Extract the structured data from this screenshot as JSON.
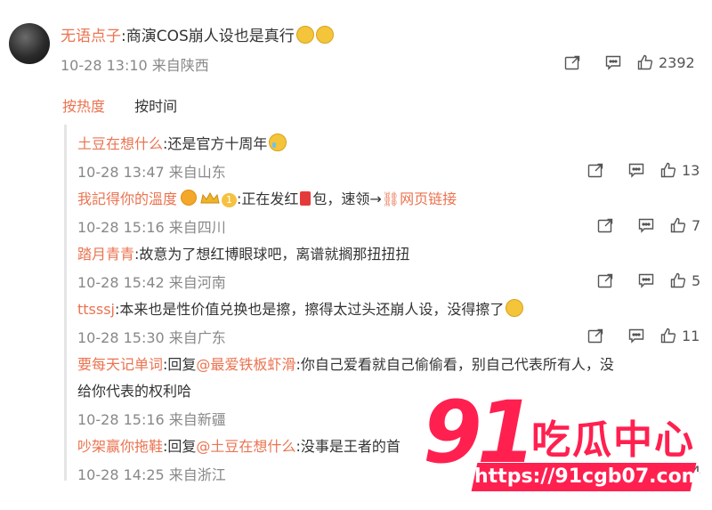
{
  "top_comment": {
    "username": "无语点子",
    "text": ":商演COS崩人设也是真行",
    "time": "10-28 13:10",
    "location": "来自陕西",
    "likes": "2392"
  },
  "sort": {
    "hot": "按热度",
    "time": "按时间"
  },
  "replies": [
    {
      "username": "土豆在想什么",
      "text": ":还是官方十周年",
      "time": "10-28 13:47",
      "location": "来自山东",
      "likes": "13"
    },
    {
      "username": "我記得你的溫度",
      "badge_level": "1",
      "text_before": ":正在发红",
      "text_after": "包，速领→",
      "link": "网页链接",
      "time": "10-28 15:16",
      "location": "来自四川",
      "likes": "7"
    },
    {
      "username": "踏月青青",
      "text": ":故意为了想红博眼球吧，离谱就搁那扭扭扭",
      "time": "10-28 15:42",
      "location": "来自河南",
      "likes": "5"
    },
    {
      "username": "ttsssj",
      "text": ":本来也是性价值兑换也是擦，擦得太过头还崩人设，没得擦了",
      "time": "10-28 15:30",
      "location": "来自广东",
      "likes": "11"
    },
    {
      "username": "要每天记单词",
      "text_pre": ":回复",
      "mention": "@最爱铁板虾滑",
      "text_line1": ":你自己爱看就自己偷偷看，别自己代表所有人，没",
      "text_line2": "给你代表的权利哈",
      "time": "10-28 15:16",
      "location": "来自新疆"
    },
    {
      "username": "吵架赢你拖鞋",
      "text_pre": ":回复",
      "mention": "@土豆在想什么",
      "text": ":没事是王者的首",
      "time": "10-28 14:25",
      "location": "来自浙江",
      "likes_partial": "54"
    }
  ],
  "watermark": {
    "number": "91",
    "name": "吃瓜中心",
    "url": "https://91cgb07.com"
  },
  "colors": {
    "username": "#eb7350",
    "text": "#333333",
    "meta": "#888888",
    "watermark": "#ff2050"
  },
  "icons": [
    "share-icon",
    "comment-icon",
    "like-icon"
  ]
}
